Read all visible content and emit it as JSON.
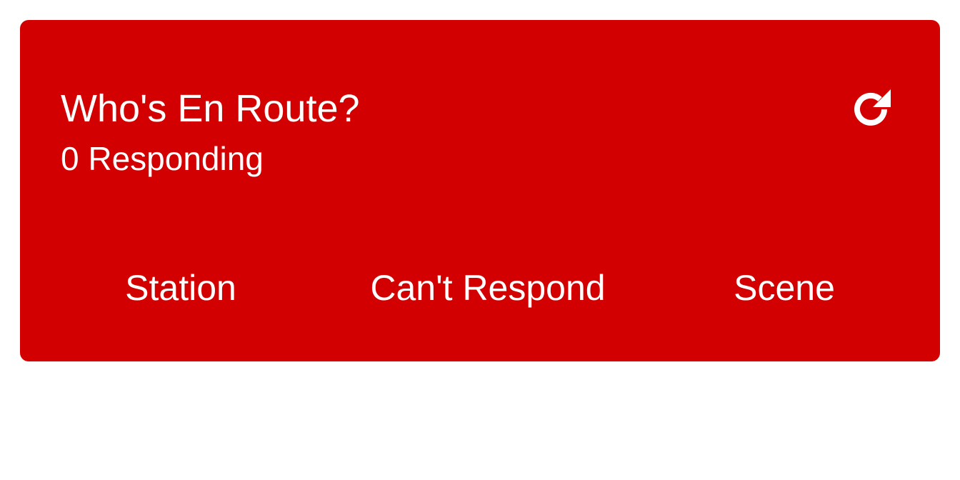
{
  "colors": {
    "card_background": "#d20000",
    "text": "#ffffff",
    "page_background": "#ffffff"
  },
  "card": {
    "title": "Who's En Route?",
    "subtitle": "0 Responding",
    "refresh_icon": "refresh-icon"
  },
  "actions": {
    "station_label": "Station",
    "cant_respond_label": "Can't Respond",
    "scene_label": "Scene"
  }
}
